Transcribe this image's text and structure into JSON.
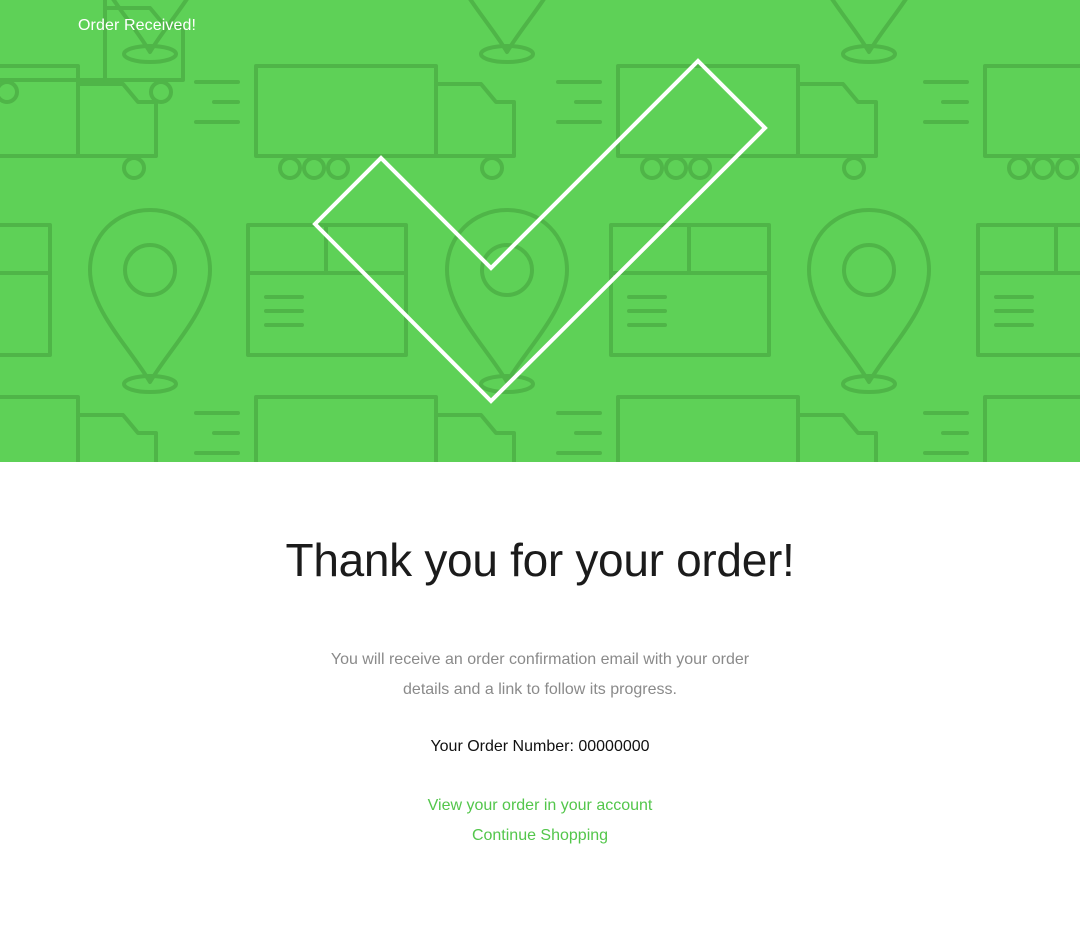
{
  "hero": {
    "title": "Order Received!",
    "background_color": "#5ed157",
    "pattern_icons": [
      "truck-icon",
      "box-icon",
      "map-pin-icon"
    ],
    "center_icon": "checkmark-icon"
  },
  "main": {
    "heading": "Thank you for your order!",
    "message": "You will receive an order confirmation email with your order details and a link to follow its progress.",
    "order_number": "Your Order Number: 00000000"
  },
  "links": {
    "view_order": "View your order in your account",
    "continue_shopping": "Continue Shopping",
    "link_color": "#53c64b"
  }
}
